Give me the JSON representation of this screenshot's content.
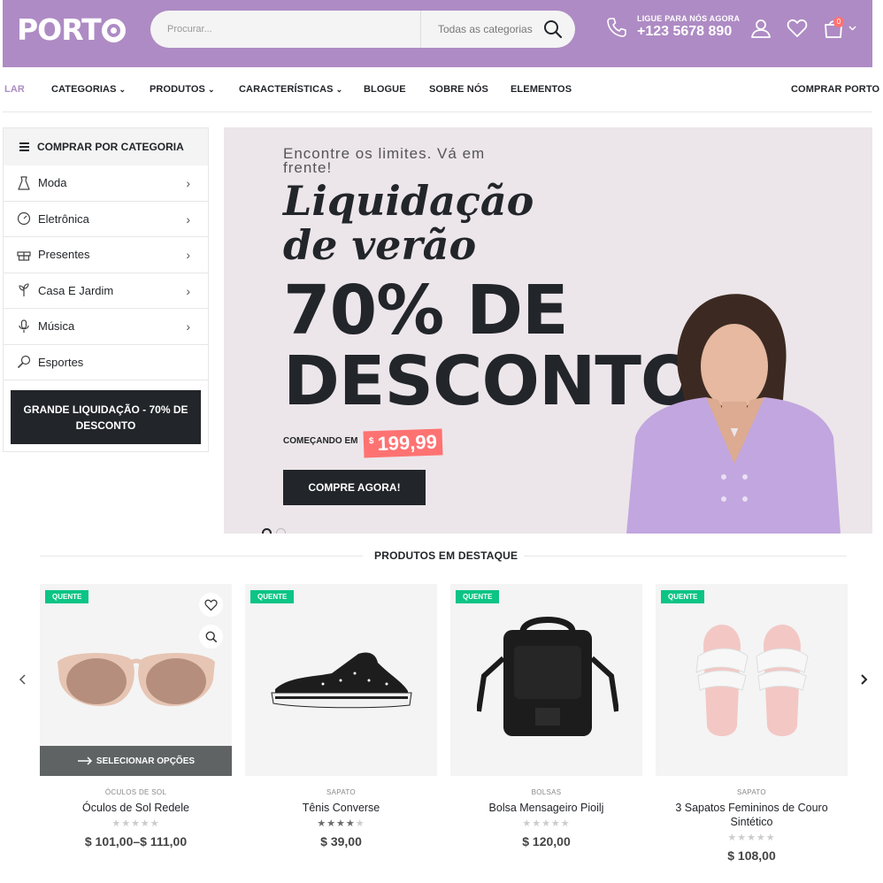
{
  "brand": {
    "logo_text": "PORT"
  },
  "search": {
    "placeholder": "Procurar...",
    "category": "Todas as categorias"
  },
  "contact": {
    "label": "LIGUE PARA NÓS AGORA",
    "phone": "+123 5678 890"
  },
  "cart": {
    "count": "0"
  },
  "nav": {
    "items": [
      {
        "label": "LAR",
        "dropdown": false,
        "active": true
      },
      {
        "label": "CATEGORIAS",
        "dropdown": true
      },
      {
        "label": "PRODUTOS",
        "dropdown": true
      },
      {
        "label": "CARACTERÍSTICAS",
        "dropdown": true
      },
      {
        "label": "BLOGUE",
        "dropdown": false
      },
      {
        "label": "SOBRE NÓS",
        "dropdown": false
      },
      {
        "label": "ELEMENTOS",
        "dropdown": false
      }
    ],
    "right_link": "COMPRAR PORTO"
  },
  "sidebar": {
    "title": "COMPRAR POR CATEGORIA",
    "items": [
      {
        "label": "Moda",
        "icon": "dress-icon",
        "has_children": true
      },
      {
        "label": "Eletrônica",
        "icon": "gauge-icon",
        "has_children": true
      },
      {
        "label": "Presentes",
        "icon": "gift-icon",
        "has_children": true
      },
      {
        "label": "Casa E Jardim",
        "icon": "plant-icon",
        "has_children": true
      },
      {
        "label": "Música",
        "icon": "microphone-icon",
        "has_children": true
      },
      {
        "label": "Esportes",
        "icon": "tennis-racket-icon",
        "has_children": false
      }
    ],
    "promo": "GRANDE LIQUIDAÇÃO - 70% DE DESCONTO"
  },
  "hero": {
    "kicker": "Encontre os limites. Vá em frente!",
    "title_line1": "Liquidação",
    "title_line2": "de verão",
    "big_line1": "70% DE",
    "big_line2": "DESCONTO",
    "starting_label": "COMEÇANDO EM",
    "currency": "$",
    "price": "199,99",
    "cta": "COMPRE AGORA!"
  },
  "featured": {
    "title": "PRODUTOS EM DESTAQUE",
    "select_options": "SELECIONAR OPÇÕES",
    "products": [
      {
        "badge": "QUENTE",
        "category": "ÓCULOS DE SOL",
        "name": "Óculos de Sol Redele",
        "rating": 0,
        "price": "$ 101,00–$ 111,00"
      },
      {
        "badge": "QUENTE",
        "category": "SAPATO",
        "name": "Tênis Converse",
        "rating": 4,
        "price": "$ 39,00"
      },
      {
        "badge": "QUENTE",
        "category": "BOLSAS",
        "name": "Bolsa Mensageiro Pioilj",
        "rating": 0,
        "price": "$ 120,00"
      },
      {
        "badge": "QUENTE",
        "category": "SAPATO",
        "name": "3 Sapatos Femininos de Couro Sintético",
        "rating": 0,
        "price": "$ 108,00"
      }
    ]
  },
  "colors": {
    "header_bg": "#ae8bc4",
    "dark": "#222529",
    "hot_badge": "#0cc485",
    "price_tag": "#ff7272"
  }
}
